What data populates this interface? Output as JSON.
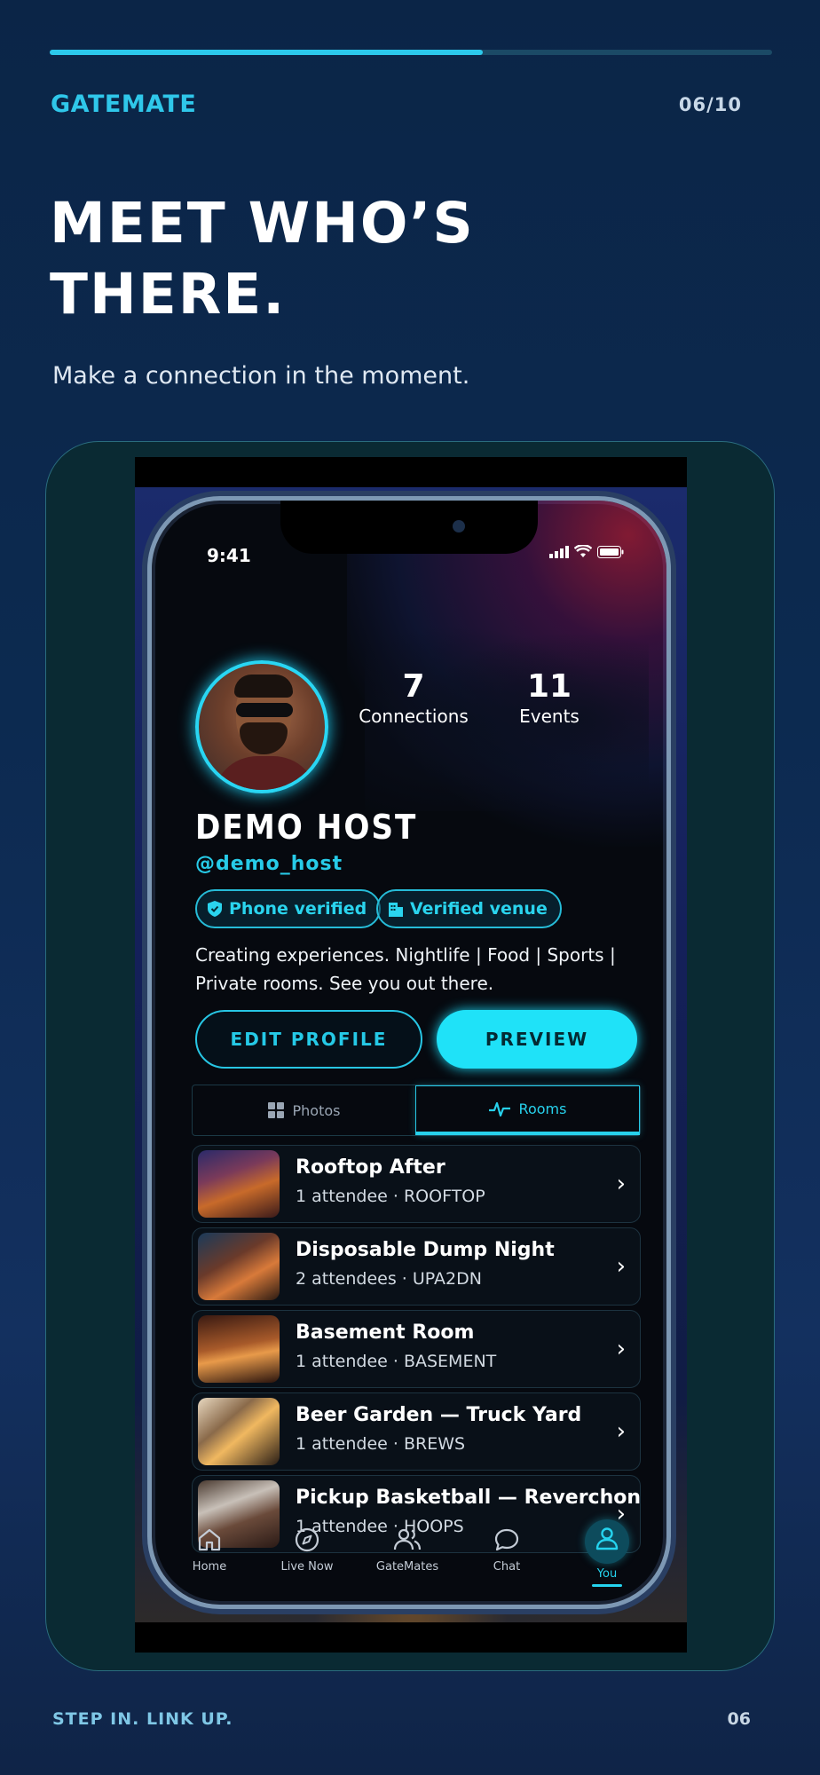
{
  "progress": {
    "fraction": 0.6
  },
  "brand": "GATEMATE",
  "counter": "06/10",
  "headline": {
    "line1": "MEET WHO’S",
    "line2": "THERE."
  },
  "subtitle": "Make a connection in the moment.",
  "phone": {
    "status_time": "9:41",
    "stats": [
      {
        "value": "7",
        "label": "Connections"
      },
      {
        "value": "11",
        "label": "Events"
      }
    ],
    "name": "DEMO HOST",
    "handle": "@demo_host",
    "badges": [
      {
        "icon": "shield-icon",
        "label": "Phone verified"
      },
      {
        "icon": "building-icon",
        "label": "Verified venue"
      }
    ],
    "bio": {
      "line1": "Creating experiences. Nightlife | Food | Sports |",
      "line2": "Private rooms. See you out there."
    },
    "buttons": {
      "edit": "EDIT PROFILE",
      "preview": "PREVIEW"
    },
    "tabs": [
      {
        "icon": "grid-icon",
        "label": "Photos",
        "active": false
      },
      {
        "icon": "activity-icon",
        "label": "Rooms",
        "active": true
      }
    ],
    "rooms": [
      {
        "title": "Rooftop After",
        "meta": "1 attendee · ROOFTOP"
      },
      {
        "title": "Disposable Dump Night",
        "meta": "2 attendees · UPA2DN"
      },
      {
        "title": "Basement Room",
        "meta": "1 attendee · BASEMENT"
      },
      {
        "title": "Beer Garden — Truck Yard",
        "meta": "1 attendee · BREWS"
      },
      {
        "title": "Pickup Basketball — Reverchon",
        "meta": "1 attendee · HOOPS"
      }
    ],
    "nav": [
      {
        "icon": "home-icon",
        "label": "Home"
      },
      {
        "icon": "compass-icon",
        "label": "Live Now"
      },
      {
        "icon": "users-icon",
        "label": "GateMates"
      },
      {
        "icon": "chat-icon",
        "label": "Chat"
      },
      {
        "icon": "user-icon",
        "label": "You",
        "active": true
      }
    ]
  },
  "footer": {
    "tagline": "STEP IN. LINK UP.",
    "page": "06"
  },
  "colors": {
    "accent": "#2cc9ec",
    "background": "#0b2547",
    "card": "#0a2a33"
  }
}
